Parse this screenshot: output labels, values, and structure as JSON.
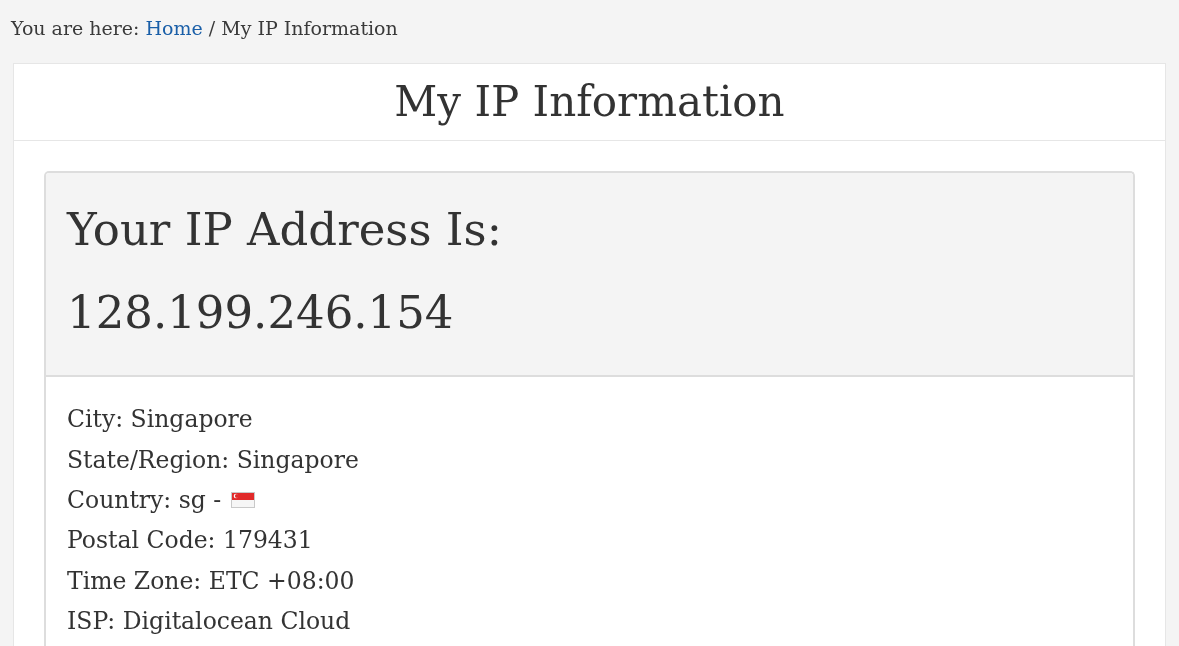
{
  "breadcrumb": {
    "prefix": "You are here:",
    "items": [
      {
        "label": "Home",
        "kind": "link"
      },
      {
        "label": "/",
        "kind": "separator"
      },
      {
        "label": "My IP Information",
        "kind": "current"
      }
    ]
  },
  "page_title": "My IP Information",
  "ip_panel": {
    "heading": "Your IP Address Is:",
    "ip": "128.199.246.154"
  },
  "details": [
    {
      "text": "City: Singapore",
      "kind": "text"
    },
    {
      "text": "State/Region: Singapore",
      "kind": "text"
    },
    {
      "text": "Country: sg -",
      "kind": "flag"
    },
    {
      "text": "Postal Code: 179431",
      "kind": "text"
    },
    {
      "text": "Time Zone: ETC +08:00",
      "kind": "text"
    },
    {
      "text": "ISP: Digitalocean Cloud",
      "kind": "text"
    }
  ]
}
